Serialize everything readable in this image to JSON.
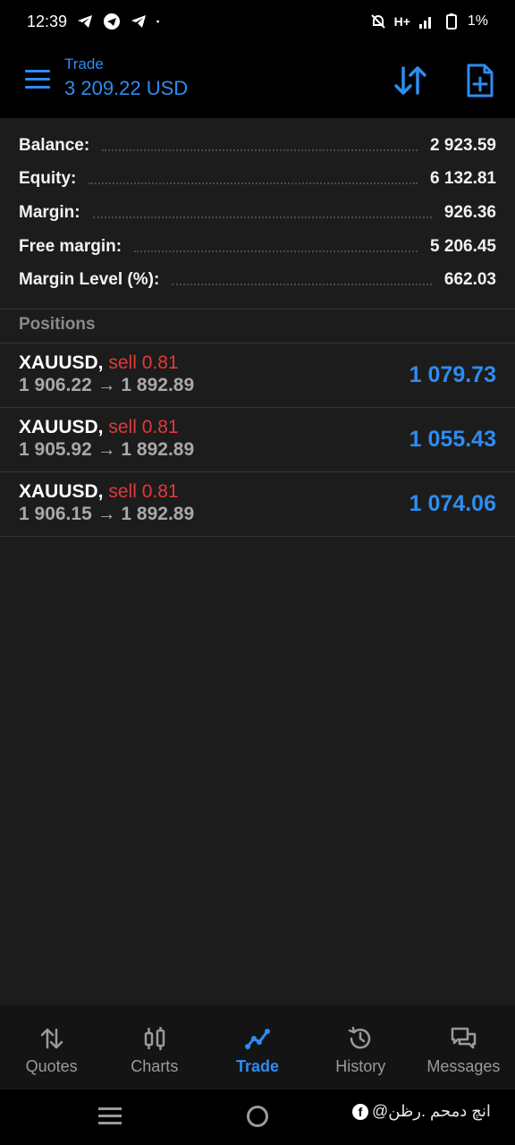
{
  "status_bar": {
    "time": "12:39",
    "network": "H+",
    "battery": "1%"
  },
  "header": {
    "title": "Trade",
    "subtitle": "3 209.22 USD"
  },
  "summary": [
    {
      "label": "Balance:",
      "value": "2 923.59"
    },
    {
      "label": "Equity:",
      "value": "6 132.81"
    },
    {
      "label": "Margin:",
      "value": "926.36"
    },
    {
      "label": "Free margin:",
      "value": "5 206.45"
    },
    {
      "label": "Margin Level (%):",
      "value": "662.03"
    }
  ],
  "positions_header": "Positions",
  "positions": [
    {
      "symbol": "XAUUSD,",
      "direction": "sell 0.81",
      "prices": "1 906.22 → 1 892.89",
      "profit": "1 079.73"
    },
    {
      "symbol": "XAUUSD,",
      "direction": "sell 0.81",
      "prices": "1 905.92 → 1 892.89",
      "profit": "1 055.43"
    },
    {
      "symbol": "XAUUSD,",
      "direction": "sell 0.81",
      "prices": "1 906.15 → 1 892.89",
      "profit": "1 074.06"
    }
  ],
  "nav": [
    {
      "label": "Quotes",
      "icon": "quotes-icon"
    },
    {
      "label": "Charts",
      "icon": "charts-icon"
    },
    {
      "label": "Trade",
      "icon": "trade-icon",
      "active": true
    },
    {
      "label": "History",
      "icon": "history-icon"
    },
    {
      "label": "Messages",
      "icon": "messages-icon"
    }
  ],
  "watermark": "انچ دمحم .رظن@",
  "colors": {
    "accent": "#2e8cf0",
    "sell": "#e03a3a",
    "background": "#1c1c1c"
  }
}
